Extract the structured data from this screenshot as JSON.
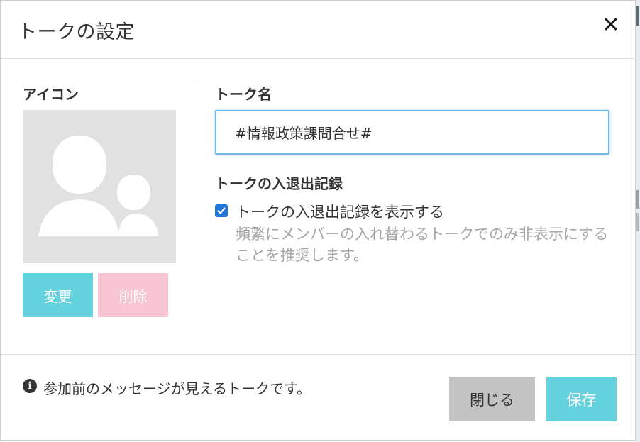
{
  "dialog": {
    "title": "トークの設定",
    "close_glyph": "✕"
  },
  "icon_section": {
    "label": "アイコン",
    "avatar_icon": "group-avatar-icon",
    "change_label": "変更",
    "delete_label": "削除"
  },
  "name_section": {
    "label": "トーク名",
    "value": "#情報政策課問合せ#"
  },
  "log_section": {
    "label": "トークの入退出記録",
    "checkbox_label": "トークの入退出記録を表示する",
    "checked": true,
    "hint": "頻繁にメンバーの入れ替わるトークでのみ非表示にすることを推奨します。"
  },
  "footer": {
    "info_icon": "info-icon",
    "info_text": "参加前のメッセージが見えるトークです。",
    "close_label": "閉じる",
    "save_label": "保存"
  },
  "colors": {
    "accent": "#64d3dd",
    "delete_disabled": "#f8c6d2",
    "close_button": "#c3c3c3",
    "checkbox": "#1f77d9",
    "input_border": "#74b8e6"
  }
}
